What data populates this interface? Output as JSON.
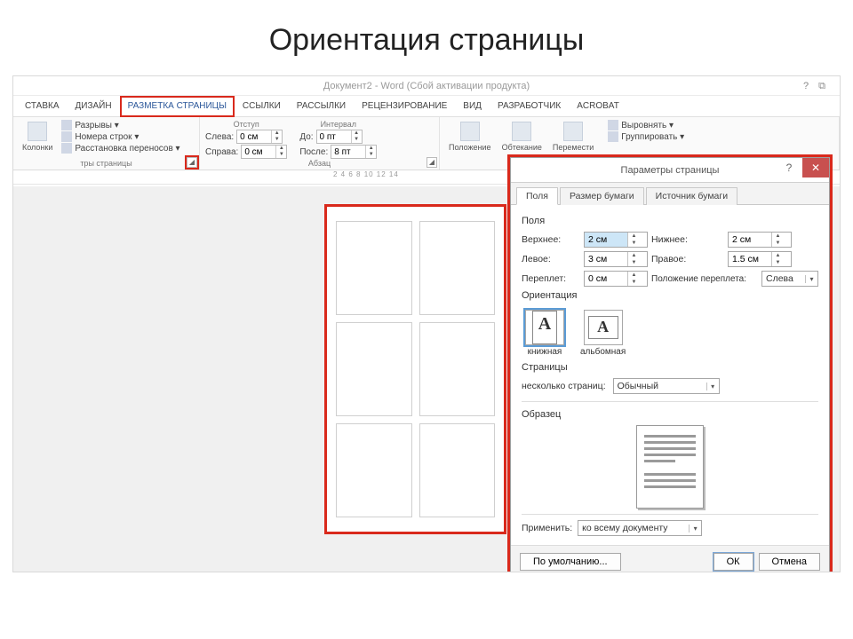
{
  "slide": {
    "title": "Ориентация страницы"
  },
  "window": {
    "title": "Документ2 - Word (Сбой активации продукта)",
    "help_icons": "?  ⧉"
  },
  "tabs": {
    "items": [
      "СТАВКА",
      "ДИЗАЙН",
      "РАЗМЕТКА СТРАНИЦЫ",
      "ССЫЛКИ",
      "РАССЫЛКИ",
      "РЕЦЕНЗИРОВАНИЕ",
      "ВИД",
      "РАЗРАБОТЧИК",
      "ACROBAT"
    ],
    "active_index": 2
  },
  "ribbon": {
    "group1": {
      "columns_label": "Колонки",
      "items": [
        "Разрывы ▾",
        "Номера строк ▾",
        "Расстановка переносов ▾"
      ],
      "label": "тры страницы"
    },
    "group2": {
      "title": "Отступ",
      "left_label": "Слева:",
      "left_value": "0 см",
      "right_label": "Справа:",
      "right_value": "0 см",
      "title2": "Интервал",
      "before_label": "До:",
      "before_value": "0 пт",
      "after_label": "После:",
      "after_value": "8 пт",
      "label": "Абзац"
    },
    "group3": {
      "buttons": [
        "Положение",
        "Обтекание\nтекстом",
        "Перемести\nвперед"
      ],
      "arrange": [
        "Выровнять ▾",
        "Группировать ▾"
      ]
    }
  },
  "ruler": "2  4  6  8  10  12  14",
  "dialog": {
    "title": "Параметры страницы",
    "tabs": [
      "Поля",
      "Размер бумаги",
      "Источник бумаги"
    ],
    "fields_section": "Поля",
    "top": {
      "label": "Верхнее:",
      "value": "2 см"
    },
    "bottom": {
      "label": "Нижнее:",
      "value": "2 см"
    },
    "left": {
      "label": "Левое:",
      "value": "3 см"
    },
    "right": {
      "label": "Правое:",
      "value": "1.5 см"
    },
    "gutter": {
      "label": "Переплет:",
      "value": "0 см"
    },
    "gutter_pos": {
      "label": "Положение переплета:",
      "value": "Слева"
    },
    "orient_section": "Ориентация",
    "portrait_label": "книжная",
    "landscape_label": "альбомная",
    "pages_section": "Страницы",
    "multipage_label": "несколько страниц:",
    "multipage_value": "Обычный",
    "sample_section": "Образец",
    "apply_label": "Применить:",
    "apply_value": "ко всему документу",
    "default_btn": "По умолчанию...",
    "ok_btn": "ОК",
    "cancel_btn": "Отмена"
  }
}
